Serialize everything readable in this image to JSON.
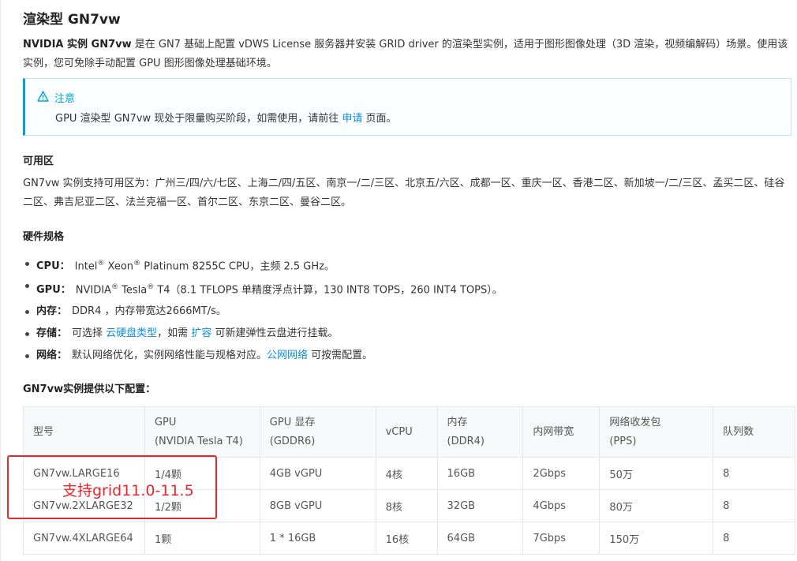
{
  "title": "渲染型 GN7vw",
  "intro": {
    "bold": "NVIDIA 实例 GN7vw",
    "text": " 是在 GN7 基础上配置 vDWS License 服务器并安装 GRID driver 的渲染型实例，适用于图形图像处理（3D 渲染，视频编解码）场景。使用该实例，您可免除手动配置 GPU 图形图像处理基础环境。"
  },
  "note": {
    "heading": "注意",
    "text_before": "GPU 渲染型 GN7vw 现处于限量购买阶段，如需使用，请前往 ",
    "link": "申请",
    "text_after": " 页面。",
    "accent": "#00a3d9"
  },
  "availability": {
    "heading": "可用区",
    "text": "GN7vw 实例支持可用区为：广州三/四/六/七区、上海二/四/五区、南京一/二/三区、北京五/六区、成都一区、重庆一区、香港二区、新加坡一/二/三区、孟买二区、硅谷二区、弗吉尼亚二区、法兰克福一区、首尔二区、东京二区、曼谷二区。"
  },
  "hardware": {
    "heading": "硬件规格",
    "cpu": {
      "key": "CPU：",
      "a": "Intel",
      "b": " Xeon",
      "c": " Platinum 8255C CPU，主频 2.5 GHz。",
      "reg": "®"
    },
    "gpu": {
      "key": "GPU：",
      "a": "NVIDIA",
      "b": " Tesla",
      "c": " T4（8.1 TFLOPS 单精度浮点计算，130 INT8 TOPS，260 INT4 TOPS）。",
      "reg": "®"
    },
    "mem": {
      "key": "内存：",
      "text": "DDR4 ，内存带宽达2666MT/s。"
    },
    "storage": {
      "key": "存储：",
      "a": "可选择 ",
      "link1": "云硬盘类型",
      "b": "，如需 ",
      "link2": "扩容",
      "c": " 可新建弹性云盘进行挂载。"
    },
    "network": {
      "key": "网络：",
      "a": "默认网络优化，实例网络性能与规格对应。",
      "link": "公网网络",
      "b": " 可按需配置。"
    }
  },
  "config": {
    "heading": "GN7vw实例提供以下配置：",
    "headers": [
      [
        "型号"
      ],
      [
        "GPU",
        "(NVIDIA Tesla T4)"
      ],
      [
        "GPU 显存",
        "(GDDR6)"
      ],
      [
        "vCPU"
      ],
      [
        "内存",
        "(DDR4)"
      ],
      [
        "内网带宽"
      ],
      [
        "网络收发包",
        "(PPS)"
      ],
      [
        "队列数"
      ]
    ],
    "rows": [
      [
        "GN7vw.LARGE16",
        "1/4颗",
        "4GB vGPU",
        "4核",
        "16GB",
        "2Gbps",
        "50万",
        "8"
      ],
      [
        "GN7vw.2XLARGE32",
        "1/2颗",
        "8GB vGPU",
        "8核",
        "32GB",
        "4Gbps",
        "80万",
        "8"
      ],
      [
        "GN7vw.4XLARGE64",
        "1颗",
        "1 * 16GB",
        "16核",
        "64GB",
        "7Gbps",
        "150万",
        "8"
      ]
    ]
  },
  "annotation": {
    "text": "支持grid11.0-11.5",
    "color": "#e8262b"
  }
}
